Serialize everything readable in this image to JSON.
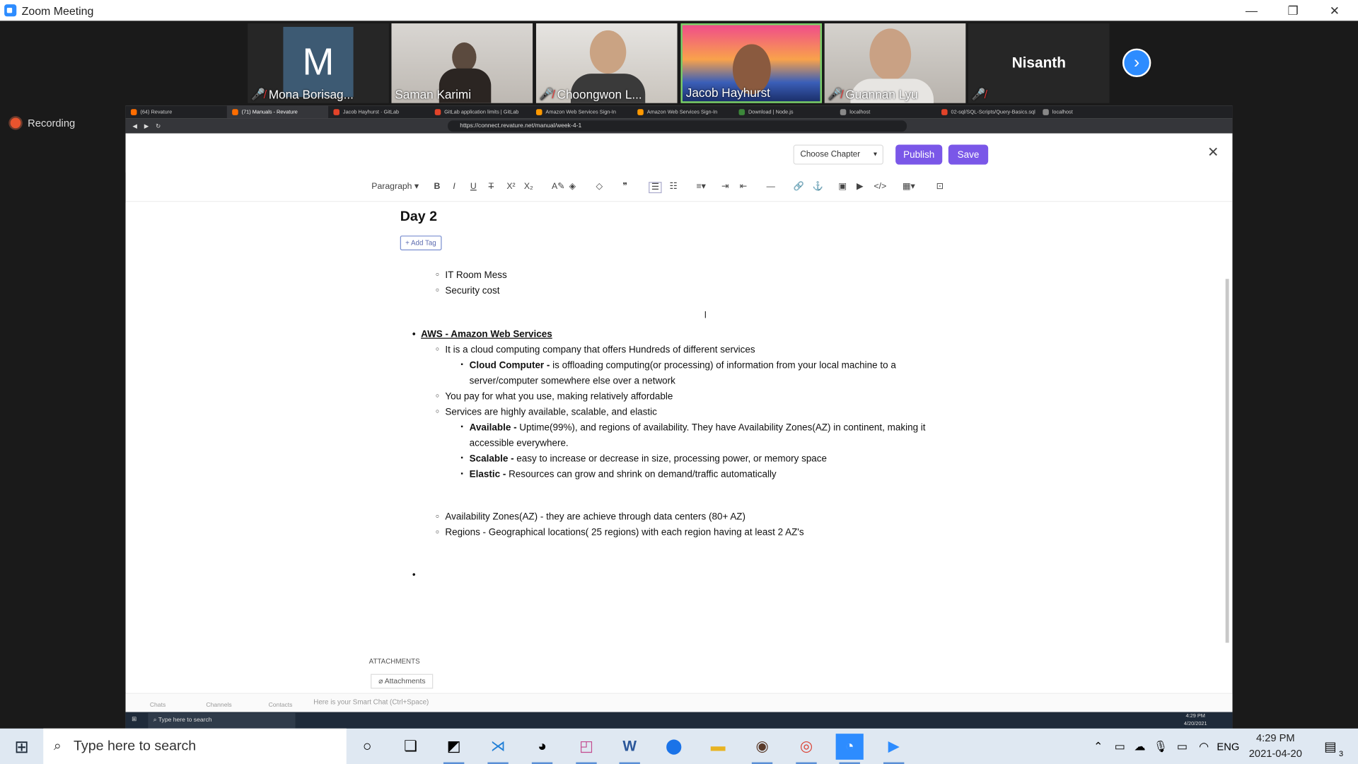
{
  "window": {
    "title": "Zoom Meeting",
    "minimize": "—",
    "restore": "❐",
    "close": "✕"
  },
  "participants": [
    {
      "name": "Mona Borisag...",
      "muted": true,
      "avatar_letter": "M"
    },
    {
      "name": "Saman Karimi",
      "muted": false
    },
    {
      "name": "Choongwon L...",
      "muted": true
    },
    {
      "name": "Jacob Hayhurst",
      "muted": false
    },
    {
      "name": "Guannan Lyu",
      "muted": true
    },
    {
      "name": "Nisanth",
      "muted": true
    }
  ],
  "recording_label": "Recording",
  "browser": {
    "tabs": [
      "(64) Revature",
      "(71) Manuals - Revature",
      "Jacob Hayhurst · GitLab",
      "GitLab application limits | GitLab",
      "Amazon Web Services Sign-In",
      "Amazon Web Services Sign-In",
      "Download | Node.js",
      "localhost",
      "02-sql/SQL-Scripts/Query-Basics.sql",
      "localhost"
    ],
    "url": "https://connect.revature.net/manual/week-4-1"
  },
  "editor": {
    "choose_chapter": "Choose Chapter",
    "publish": "Publish",
    "save": "Save",
    "paragraph": "Paragraph",
    "title": "Day 2",
    "add_tag": "+ Add Tag",
    "attachments_heading": "ATTACHMENTS",
    "attachments_button": "Attachments"
  },
  "content": {
    "l1": "IT Room Mess",
    "l2": "Security cost",
    "aws": "AWS - Amazon Web Services",
    "l3": "It is a cloud computing company that offers Hundreds of different services",
    "cc_b": "Cloud Computer -",
    "cc_t": " is offloading computing(or processing) of information from your local machine to a",
    "cc_t2": "server/computer somewhere else over a network",
    "l4": "You pay for what you use, making relatively affordable",
    "l5": "Services are highly available, scalable, and elastic",
    "av_b": "Available -",
    "av_t": " Uptime(99%), and regions of availability. They have Availability Zones(AZ) in continent, making it",
    "av_t2": "accessible everywhere.",
    "sc_b": "Scalable -",
    "sc_t": " easy to increase or decrease in size, processing power, or memory space",
    "el_b": "Elastic -",
    "el_t": " Resources can grow and shrink on demand/traffic automatically",
    "l6": "Availability Zones(AZ) - they are achieve through data centers (80+ AZ)",
    "l7": "Regions - Geographical locations( 25 regions) with each region having at least 2 AZ's"
  },
  "inner_chat": {
    "chats": "Chats",
    "channels": "Channels",
    "contacts": "Contacts",
    "hint": "Here is your Smart Chat (Ctrl+Space)"
  },
  "inner_taskbar": {
    "search": "Type here to search",
    "time": "4:29 PM",
    "date": "4/20/2021"
  },
  "taskbar": {
    "search_placeholder": "Type here to search",
    "time": "4:29 PM",
    "date": "2021-04-20",
    "lang": "ENG",
    "notif_count": "3"
  }
}
